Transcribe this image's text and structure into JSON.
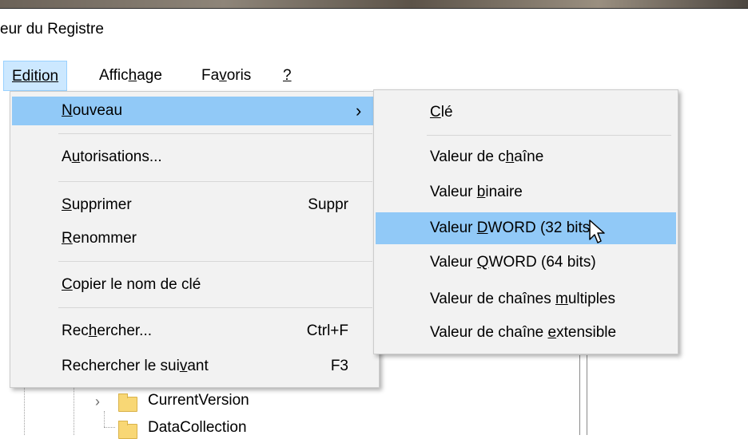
{
  "window": {
    "title": "eur du Registre"
  },
  "menubar": {
    "edition": "Edition",
    "affichage": {
      "pre": "Affic",
      "u": "h",
      "post": "age"
    },
    "favoris": {
      "pre": "Fa",
      "u": "v",
      "post": "oris"
    },
    "help": "?"
  },
  "edit_menu": {
    "nouveau": {
      "u": "N",
      "post": "ouveau",
      "arrow": "›"
    },
    "autorisations": {
      "pre": "A",
      "u": "u",
      "post": "torisations..."
    },
    "supprimer": {
      "u": "S",
      "post": "upprimer",
      "shortcut": "Suppr"
    },
    "renommer": {
      "u": "R",
      "post": "enommer"
    },
    "copier": {
      "u": "C",
      "post": "opier le nom de clé"
    },
    "rechercher": {
      "pre": "Rec",
      "u": "h",
      "post": "ercher...",
      "shortcut": "Ctrl+F"
    },
    "suivant": {
      "pre": "Rechercher le sui",
      "u": "v",
      "post": "ant",
      "shortcut": "F3"
    }
  },
  "submenu": {
    "cle": {
      "u": "C",
      "post": "lé"
    },
    "chaine": {
      "pre": "Valeur de c",
      "u": "h",
      "post": "aîne"
    },
    "binaire": {
      "pre": "Valeur ",
      "u": "b",
      "post": "inaire"
    },
    "dword": {
      "pre": "Valeur ",
      "u": "D",
      "post": "WORD (32 bits)"
    },
    "qword": {
      "pre": "Valeur ",
      "u": "Q",
      "post": "WORD (64 bits)"
    },
    "multiples": {
      "pre": "Valeur de chaînes ",
      "u": "m",
      "post": "ultiples"
    },
    "extensible": {
      "pre": "Valeur de chaîne ",
      "u": "e",
      "post": "xtensible"
    }
  },
  "tree": {
    "item1": "CurrentVersion",
    "item2": "DataCollection"
  },
  "colors": {
    "highlight": "#91c9f7",
    "menu_bg": "#f2f2f2",
    "menubar_active": "#cce8ff",
    "folder": "#f8d775"
  },
  "icons": [
    "chevron-right-icon",
    "folder-icon",
    "mouse-cursor-icon"
  ]
}
